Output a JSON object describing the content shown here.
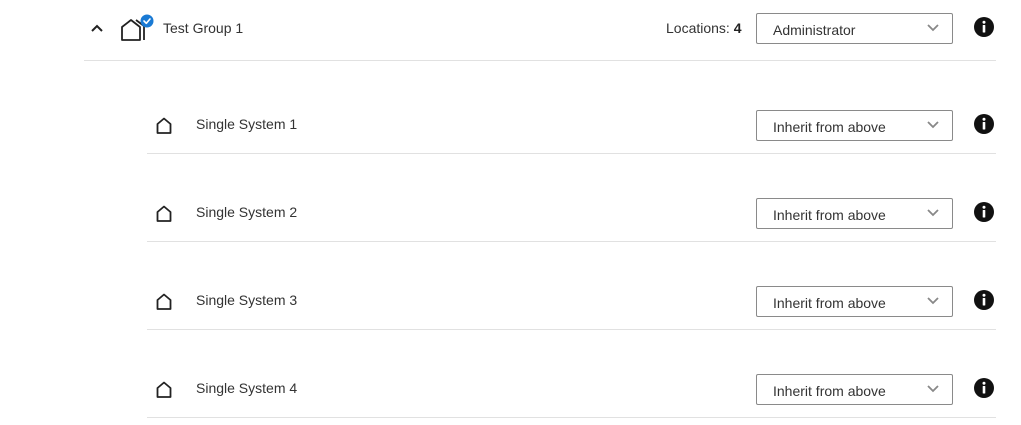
{
  "group": {
    "label": "Test Group 1",
    "locations_label": "Locations:",
    "locations_count": "4",
    "role": "Administrator",
    "expanded": true,
    "selected": true
  },
  "systems": [
    {
      "label": "Single System 1",
      "role": "Inherit from above"
    },
    {
      "label": "Single System 2",
      "role": "Inherit from above"
    },
    {
      "label": "Single System 3",
      "role": "Inherit from above"
    },
    {
      "label": "Single System 4",
      "role": "Inherit from above"
    }
  ],
  "colors": {
    "accent": "#1a7ad4",
    "divider": "#e1e1e1",
    "text": "#333333",
    "icon": "#222222"
  },
  "icons": {
    "collapse": "chevron-up-icon",
    "group": "house-group-icon",
    "check": "check-badge-icon",
    "system": "house-icon",
    "caret": "chevron-down-icon",
    "info": "info-icon"
  }
}
